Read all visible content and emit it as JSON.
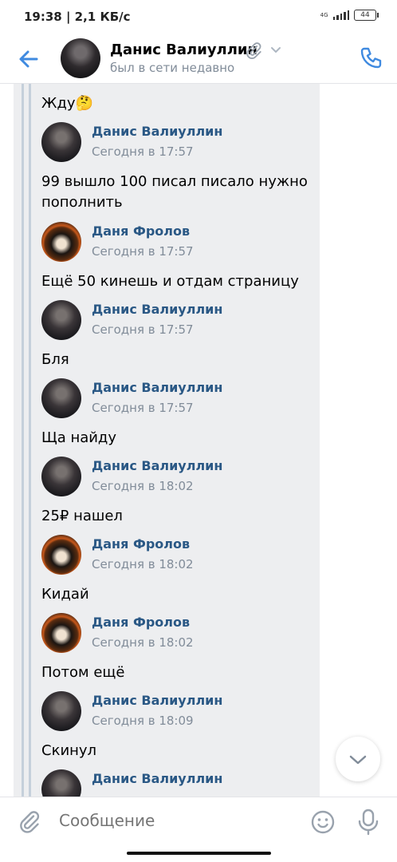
{
  "status_bar": {
    "time": "19:38 | 2,1 КБ/с",
    "network": "4G",
    "battery": "44"
  },
  "header": {
    "name": "Данис Валиуллин",
    "status": "был в сети недавно",
    "back_icon": "arrow-left-icon",
    "call_icon": "phone-icon",
    "attachment_icon": "paperclip-icon"
  },
  "messages": [
    {
      "text": "Жду🤔"
    },
    {
      "author": "Данис Валиуллин",
      "time": "Сегодня в 17:57",
      "text": "99 вышло 100 писал писало нужно пополнить"
    },
    {
      "author": "Даня Фролов",
      "time": "Сегодня в 17:57",
      "text": "Ещё 50 кинешь и отдам страницу"
    },
    {
      "author": "Данис Валиуллин",
      "time": "Сегодня в 17:57",
      "text": "Бля"
    },
    {
      "author": "Данис Валиуллин",
      "time": "Сегодня в 17:57",
      "text": "Ща найду"
    },
    {
      "author": "Данис Валиуллин",
      "time": "Сегодня в 18:02",
      "text": "25₽ нашел"
    },
    {
      "author": "Даня Фролов",
      "time": "Сегодня в 18:02",
      "text": "Кидай"
    },
    {
      "author": "Даня Фролов",
      "time": "Сегодня в 18:02",
      "text": "Потом ещё"
    },
    {
      "author": "Данис Валиуллин",
      "time": "Сегодня в 18:09",
      "text": "Скинул"
    },
    {
      "author": "Данис Валиуллин"
    }
  ],
  "composer": {
    "placeholder": "Сообщение"
  },
  "colors": {
    "accent": "#2a5885",
    "icon_blue": "#3f8ae0",
    "muted": "#818c99",
    "forward_bg": "#edeef0"
  }
}
